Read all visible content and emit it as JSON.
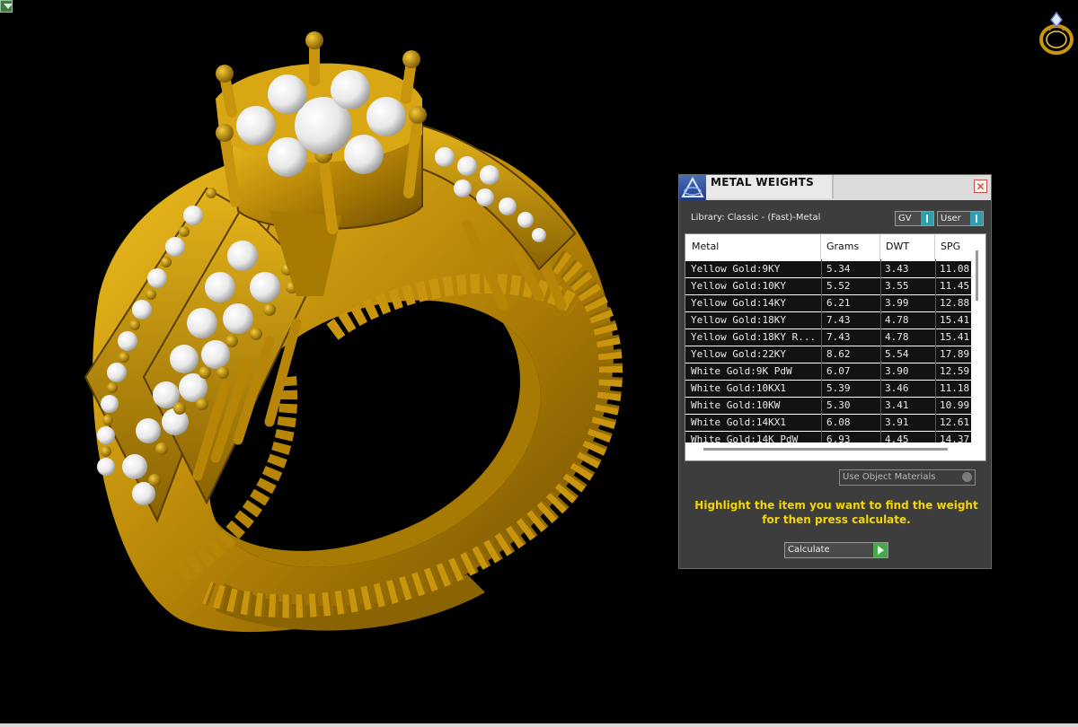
{
  "panel": {
    "title": "METAL WEIGHTS",
    "close_glyph": "✕",
    "library_label": "Library: Classic - (Fast)-Metal",
    "select_unit": "GV",
    "select_source": "User",
    "columns": [
      "Metal",
      "Grams",
      "DWT",
      "SPG"
    ],
    "rows": [
      {
        "metal": "Yellow Gold:9KY",
        "grams": "5.34",
        "dwt": "3.43",
        "spg": "11.08"
      },
      {
        "metal": "Yellow Gold:10KY",
        "grams": "5.52",
        "dwt": "3.55",
        "spg": "11.45"
      },
      {
        "metal": "Yellow Gold:14KY",
        "grams": "6.21",
        "dwt": "3.99",
        "spg": "12.88"
      },
      {
        "metal": "Yellow Gold:18KY",
        "grams": "7.43",
        "dwt": "4.78",
        "spg": "15.41"
      },
      {
        "metal": "Yellow Gold:18KY R...",
        "grams": "7.43",
        "dwt": "4.78",
        "spg": "15.41"
      },
      {
        "metal": "Yellow Gold:22KY",
        "grams": "8.62",
        "dwt": "5.54",
        "spg": "17.89"
      },
      {
        "metal": "White Gold:9K PdW",
        "grams": "6.07",
        "dwt": "3.90",
        "spg": "12.59"
      },
      {
        "metal": "White Gold:10KX1",
        "grams": "5.39",
        "dwt": "3.46",
        "spg": "11.18"
      },
      {
        "metal": "White Gold:10KW",
        "grams": "5.30",
        "dwt": "3.41",
        "spg": "10.99"
      },
      {
        "metal": "White Gold:14KX1",
        "grams": "6.08",
        "dwt": "3.91",
        "spg": "12.61"
      },
      {
        "metal": "White Gold:14K PdW",
        "grams": "6.93",
        "dwt": "4.45",
        "spg": "14.37"
      }
    ],
    "material_select": "Use Object Materials",
    "hint_line1": "Highlight the item you want to find the weight",
    "hint_line2": "for then press calculate.",
    "calculate_label": "Calculate"
  },
  "icons": {
    "corner": "collapse-tab-icon",
    "badge": "ring-icon",
    "panel_logo": "app-logo-icon"
  },
  "colors": {
    "gold": "#c8950c",
    "panel_bg": "#3d3d3d",
    "hint": "#f2d60b",
    "accent_button": "#2f9fb0",
    "go_button": "#45a84a"
  }
}
